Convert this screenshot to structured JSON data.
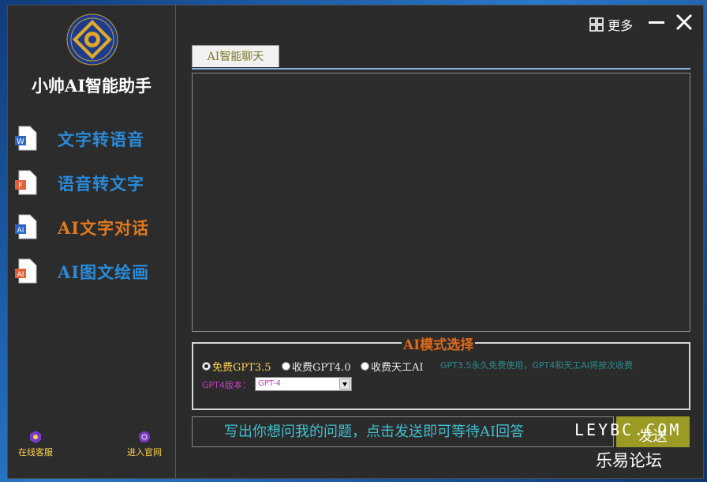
{
  "app": {
    "title": "小帅AI智能助手"
  },
  "colors": {
    "accent_blue": "#2a8ad8",
    "accent_orange": "#e07a20",
    "send_bg": "#9a9a24",
    "mode_title": "#e06a1a"
  },
  "sidebar": {
    "items": [
      {
        "label": "文字转语音",
        "icon": "word-doc-icon",
        "color": "#2a8ad8"
      },
      {
        "label": "语音转文字",
        "icon": "ppt-doc-icon",
        "color": "#2a8ad8"
      },
      {
        "label": "AI文字对话",
        "icon": "ai-doc-icon",
        "color": "#e07a20"
      },
      {
        "label": "AI图文绘画",
        "icon": "ai-doc-icon",
        "color": "#2a8ad8"
      }
    ],
    "footer": {
      "service": "在线客服",
      "website": "进入官网"
    }
  },
  "header": {
    "more_label": "更多"
  },
  "tabs": [
    {
      "label": "AI智能聊天"
    }
  ],
  "mode": {
    "title": "AI模式选择",
    "options": [
      {
        "label": "免费GPT3.5",
        "selected": true
      },
      {
        "label": "收费GPT4.0",
        "selected": false
      },
      {
        "label": "收费天工AI",
        "selected": false
      }
    ],
    "note": "GPT3.5永久免费使用，GPT4和天工AI将按次收费",
    "version_label": "GPT4版本：",
    "version_value": "GPT-4"
  },
  "input": {
    "placeholder": "写出你想问我的问题，点击发送即可等待AI回答"
  },
  "send_label": "发送",
  "watermark": {
    "line1": "LEYBC.COM",
    "line2": "乐易论坛"
  }
}
